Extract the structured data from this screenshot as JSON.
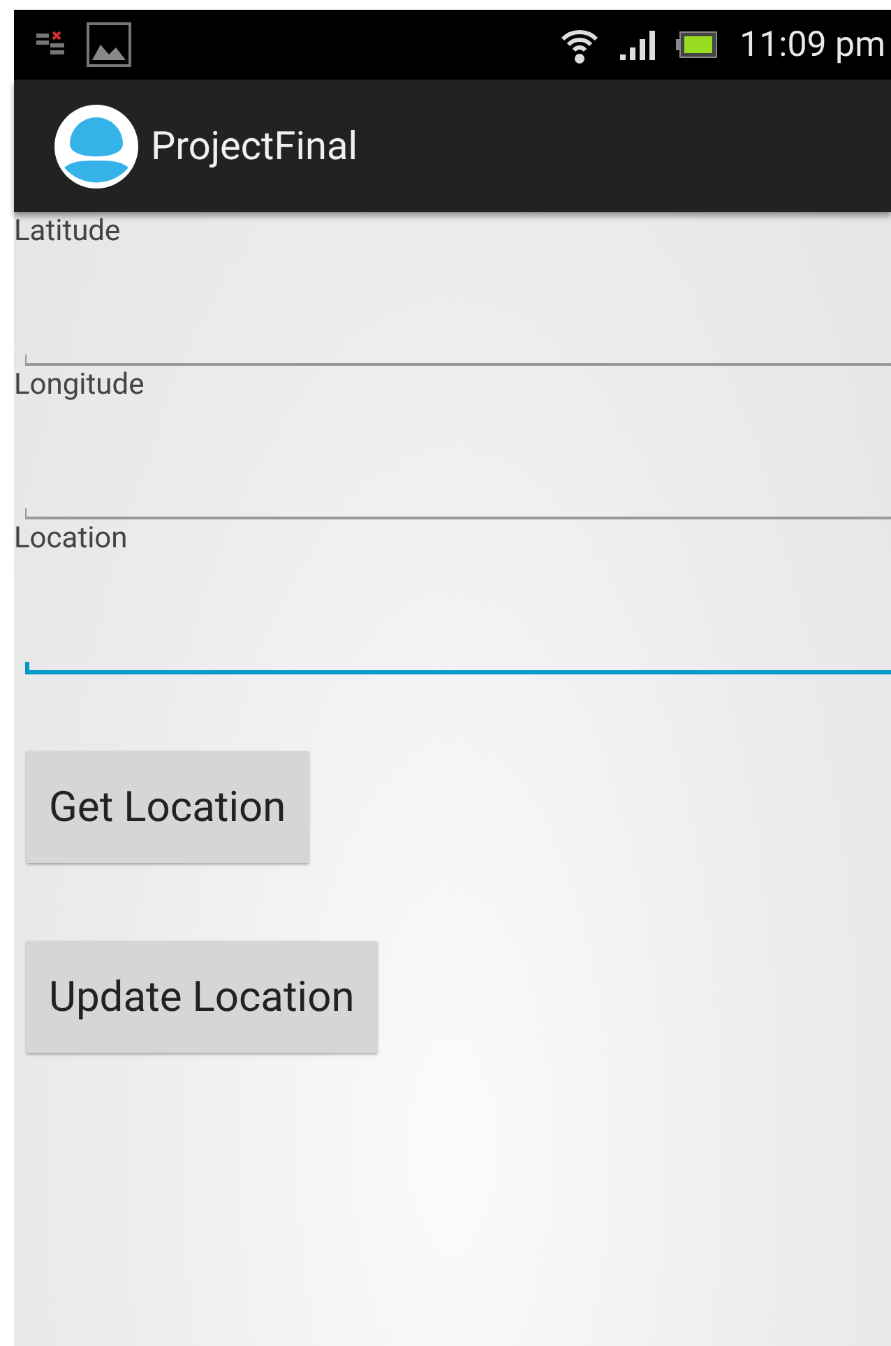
{
  "status_bar": {
    "time": "11:09 pm"
  },
  "action_bar": {
    "title": "ProjectFinal"
  },
  "fields": [
    {
      "label": "Latitude",
      "focused": false
    },
    {
      "label": "Longitude",
      "focused": false
    },
    {
      "label": "Location",
      "focused": true
    }
  ],
  "buttons": [
    "Get Location",
    "Update Location"
  ]
}
